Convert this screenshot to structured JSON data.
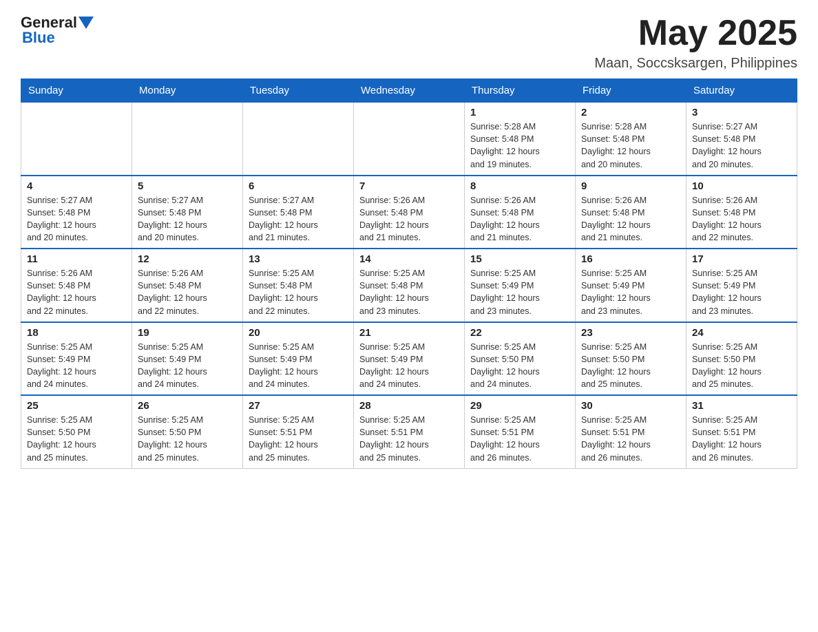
{
  "logo": {
    "general": "General",
    "blue": "Blue"
  },
  "header": {
    "month_year": "May 2025",
    "location": "Maan, Soccsksargen, Philippines"
  },
  "days_of_week": [
    "Sunday",
    "Monday",
    "Tuesday",
    "Wednesday",
    "Thursday",
    "Friday",
    "Saturday"
  ],
  "weeks": [
    [
      {
        "day": "",
        "info": ""
      },
      {
        "day": "",
        "info": ""
      },
      {
        "day": "",
        "info": ""
      },
      {
        "day": "",
        "info": ""
      },
      {
        "day": "1",
        "info": "Sunrise: 5:28 AM\nSunset: 5:48 PM\nDaylight: 12 hours\nand 19 minutes."
      },
      {
        "day": "2",
        "info": "Sunrise: 5:28 AM\nSunset: 5:48 PM\nDaylight: 12 hours\nand 20 minutes."
      },
      {
        "day": "3",
        "info": "Sunrise: 5:27 AM\nSunset: 5:48 PM\nDaylight: 12 hours\nand 20 minutes."
      }
    ],
    [
      {
        "day": "4",
        "info": "Sunrise: 5:27 AM\nSunset: 5:48 PM\nDaylight: 12 hours\nand 20 minutes."
      },
      {
        "day": "5",
        "info": "Sunrise: 5:27 AM\nSunset: 5:48 PM\nDaylight: 12 hours\nand 20 minutes."
      },
      {
        "day": "6",
        "info": "Sunrise: 5:27 AM\nSunset: 5:48 PM\nDaylight: 12 hours\nand 21 minutes."
      },
      {
        "day": "7",
        "info": "Sunrise: 5:26 AM\nSunset: 5:48 PM\nDaylight: 12 hours\nand 21 minutes."
      },
      {
        "day": "8",
        "info": "Sunrise: 5:26 AM\nSunset: 5:48 PM\nDaylight: 12 hours\nand 21 minutes."
      },
      {
        "day": "9",
        "info": "Sunrise: 5:26 AM\nSunset: 5:48 PM\nDaylight: 12 hours\nand 21 minutes."
      },
      {
        "day": "10",
        "info": "Sunrise: 5:26 AM\nSunset: 5:48 PM\nDaylight: 12 hours\nand 22 minutes."
      }
    ],
    [
      {
        "day": "11",
        "info": "Sunrise: 5:26 AM\nSunset: 5:48 PM\nDaylight: 12 hours\nand 22 minutes."
      },
      {
        "day": "12",
        "info": "Sunrise: 5:26 AM\nSunset: 5:48 PM\nDaylight: 12 hours\nand 22 minutes."
      },
      {
        "day": "13",
        "info": "Sunrise: 5:25 AM\nSunset: 5:48 PM\nDaylight: 12 hours\nand 22 minutes."
      },
      {
        "day": "14",
        "info": "Sunrise: 5:25 AM\nSunset: 5:48 PM\nDaylight: 12 hours\nand 23 minutes."
      },
      {
        "day": "15",
        "info": "Sunrise: 5:25 AM\nSunset: 5:49 PM\nDaylight: 12 hours\nand 23 minutes."
      },
      {
        "day": "16",
        "info": "Sunrise: 5:25 AM\nSunset: 5:49 PM\nDaylight: 12 hours\nand 23 minutes."
      },
      {
        "day": "17",
        "info": "Sunrise: 5:25 AM\nSunset: 5:49 PM\nDaylight: 12 hours\nand 23 minutes."
      }
    ],
    [
      {
        "day": "18",
        "info": "Sunrise: 5:25 AM\nSunset: 5:49 PM\nDaylight: 12 hours\nand 24 minutes."
      },
      {
        "day": "19",
        "info": "Sunrise: 5:25 AM\nSunset: 5:49 PM\nDaylight: 12 hours\nand 24 minutes."
      },
      {
        "day": "20",
        "info": "Sunrise: 5:25 AM\nSunset: 5:49 PM\nDaylight: 12 hours\nand 24 minutes."
      },
      {
        "day": "21",
        "info": "Sunrise: 5:25 AM\nSunset: 5:49 PM\nDaylight: 12 hours\nand 24 minutes."
      },
      {
        "day": "22",
        "info": "Sunrise: 5:25 AM\nSunset: 5:50 PM\nDaylight: 12 hours\nand 24 minutes."
      },
      {
        "day": "23",
        "info": "Sunrise: 5:25 AM\nSunset: 5:50 PM\nDaylight: 12 hours\nand 25 minutes."
      },
      {
        "day": "24",
        "info": "Sunrise: 5:25 AM\nSunset: 5:50 PM\nDaylight: 12 hours\nand 25 minutes."
      }
    ],
    [
      {
        "day": "25",
        "info": "Sunrise: 5:25 AM\nSunset: 5:50 PM\nDaylight: 12 hours\nand 25 minutes."
      },
      {
        "day": "26",
        "info": "Sunrise: 5:25 AM\nSunset: 5:50 PM\nDaylight: 12 hours\nand 25 minutes."
      },
      {
        "day": "27",
        "info": "Sunrise: 5:25 AM\nSunset: 5:51 PM\nDaylight: 12 hours\nand 25 minutes."
      },
      {
        "day": "28",
        "info": "Sunrise: 5:25 AM\nSunset: 5:51 PM\nDaylight: 12 hours\nand 25 minutes."
      },
      {
        "day": "29",
        "info": "Sunrise: 5:25 AM\nSunset: 5:51 PM\nDaylight: 12 hours\nand 26 minutes."
      },
      {
        "day": "30",
        "info": "Sunrise: 5:25 AM\nSunset: 5:51 PM\nDaylight: 12 hours\nand 26 minutes."
      },
      {
        "day": "31",
        "info": "Sunrise: 5:25 AM\nSunset: 5:51 PM\nDaylight: 12 hours\nand 26 minutes."
      }
    ]
  ]
}
